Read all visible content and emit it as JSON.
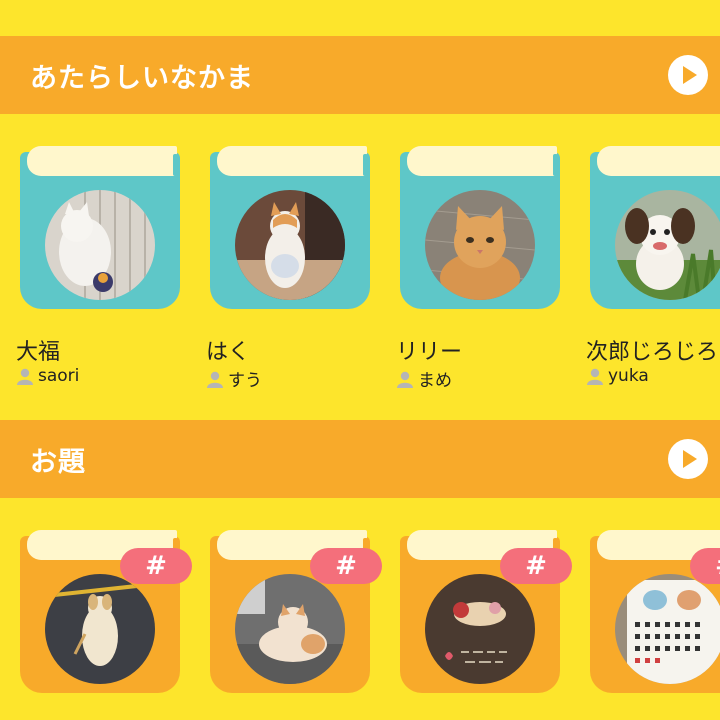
{
  "sections": {
    "new_friends": {
      "title": "あたらしいなかま"
    },
    "topics": {
      "title": "お題"
    }
  },
  "new_friends_cards": [
    {
      "name": "大福",
      "owner": "saori"
    },
    {
      "name": "はく",
      "owner": "すう"
    },
    {
      "name": "リリー",
      "owner": "まめ"
    },
    {
      "name": "次郎じろじろ",
      "owner": "yuka"
    }
  ],
  "topic_cards": [
    {
      "badge": "#"
    },
    {
      "badge": "#"
    },
    {
      "badge": "#"
    },
    {
      "badge": "#"
    }
  ],
  "colors": {
    "background": "#fde52c",
    "header": "#f8aa2a",
    "book_teal": "#5ec7c8",
    "book_orange": "#f8aa2a",
    "badge_pink": "#f46f7b"
  }
}
